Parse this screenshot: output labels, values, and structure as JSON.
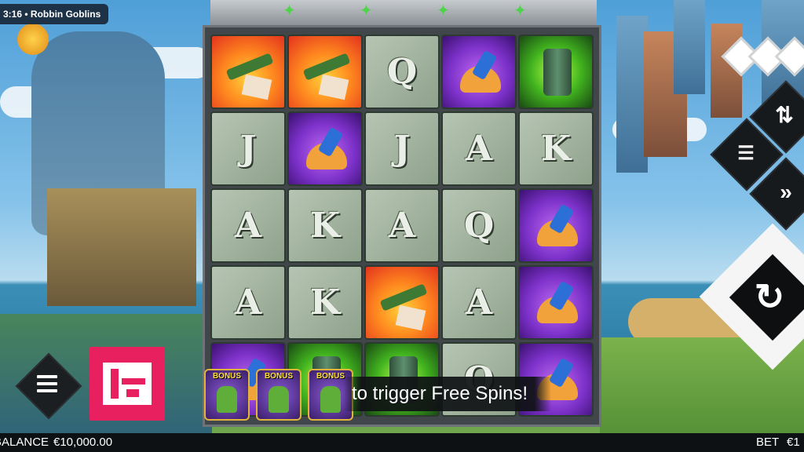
{
  "status": {
    "time": "3:16",
    "separator": "•",
    "game_title": "Robbin Goblins"
  },
  "grid": [
    [
      "bazooka",
      "bazooka",
      "Q",
      "taco",
      "barrel"
    ],
    [
      "J",
      "taco",
      "J",
      "A",
      "K"
    ],
    [
      "A",
      "K",
      "A",
      "Q",
      "taco"
    ],
    [
      "A",
      "K",
      "bazooka",
      "A",
      "taco"
    ],
    [
      "taco",
      "barrel",
      "barrel",
      "Q",
      "taco"
    ]
  ],
  "bonus": {
    "label": "BONUS",
    "count": 3
  },
  "message": "to trigger Free Spins!",
  "footer": {
    "balance_label": "BALANCE",
    "balance_value": "€10,000.00",
    "bet_label": "BET",
    "bet_value": "€1"
  },
  "icons": {
    "menu": "hamburger-icon",
    "buy_feature": "buy-feature-icon",
    "autoplay": "autoplay-icon",
    "bet_settings": "bet-settings-icon",
    "turbo": "fast-forward-icon",
    "spin": "spin-icon",
    "logo": "diamond-logo-icon"
  },
  "colors": {
    "buy_button": "#e8205f",
    "spin_button": "#f5f5f5",
    "control_dark": "#161a1d"
  }
}
